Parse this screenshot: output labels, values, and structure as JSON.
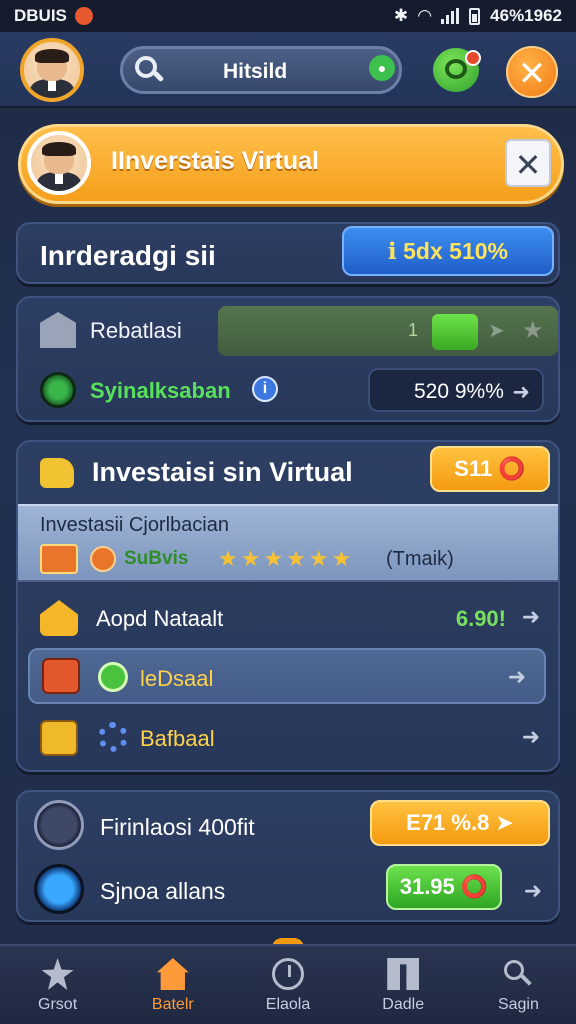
{
  "status_bar": {
    "carrier": "DBUIS",
    "time": "46%1962",
    "icons": [
      "bluetooth-icon",
      "wifi-icon",
      "signal-icon",
      "battery-icon"
    ]
  },
  "top_bar": {
    "search_text": "Hitsild",
    "icons": [
      "search-icon",
      "chat-icon",
      "close-icon"
    ]
  },
  "banner": {
    "title": "IInverstais Virtual",
    "close_label": "✕"
  },
  "header_panel": {
    "title": "Inrderadgi sii",
    "pill": "ℹ 5dx 510%"
  },
  "stats_panel": {
    "row1_label": "Rebatlasi",
    "progress_value": "1",
    "row2_label": "Syinalksaban",
    "row2_value": "520 9%%",
    "info_glyph": "i"
  },
  "invest_panel": {
    "title": "Investaisi sin Virtual",
    "pill": "S11 ⭕",
    "sub_title": "Investasii Cjorlbacian",
    "sub_label": "SuBvis",
    "rating": 6,
    "stars": "★★★★★★",
    "sub_tail": "(Tmaik)",
    "rows": [
      {
        "label": "Aopd Nataalt",
        "value": "6.90!",
        "highlight": false
      },
      {
        "label": "leDsaal",
        "value": "",
        "highlight": true
      },
      {
        "label": "Bafbaal",
        "value": "",
        "highlight": false
      }
    ]
  },
  "finance_panel": {
    "row1_label": "Firinlaosi 400fit",
    "row1_pill": "E71 %.8 ➤",
    "row2_label": "Sjnoa allans",
    "row2_pill": "31.95 ⭕"
  },
  "bottom_nav": {
    "items": [
      {
        "label": "Grsot",
        "icon": "star-icon"
      },
      {
        "label": "Batelr",
        "icon": "home-icon",
        "active": true
      },
      {
        "label": "Elaola",
        "icon": "clock-icon"
      },
      {
        "label": "Dadle",
        "icon": "document-icon"
      },
      {
        "label": "Sagin",
        "icon": "search-icon"
      }
    ]
  },
  "colors": {
    "accent_orange": "#f59f1c",
    "accent_green": "#3aa823",
    "accent_blue": "#1f5ec8",
    "background": "#1f2c49"
  }
}
